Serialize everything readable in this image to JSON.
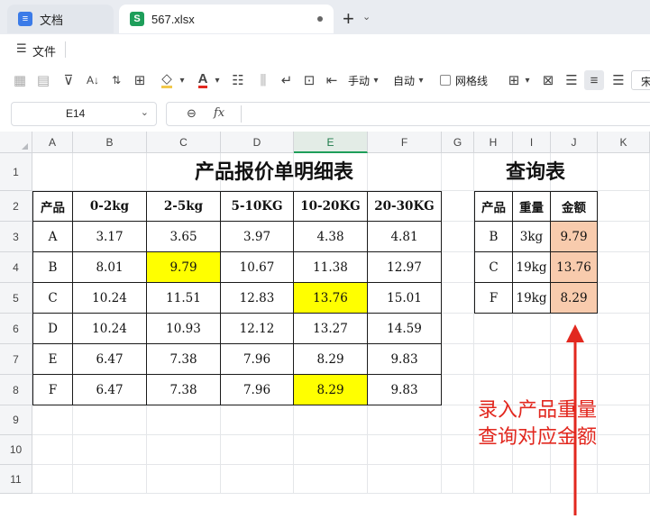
{
  "tabs": [
    {
      "label": "文档",
      "icon": "doc-icon"
    },
    {
      "label": "567.xlsx",
      "icon": "spreadsheet-icon"
    }
  ],
  "menu": {
    "file_label": "文件"
  },
  "ribbon": {
    "handdraw_label": "手动",
    "auto_label": "自动",
    "gridlines_label": "网格线",
    "overflow_char": "宋"
  },
  "namebox": {
    "value": "E14"
  },
  "formula": {
    "fx": "fx",
    "value": ""
  },
  "columns": [
    "A",
    "B",
    "C",
    "D",
    "E",
    "F",
    "G",
    "H",
    "I",
    "J",
    "K"
  ],
  "rows": [
    "1",
    "2",
    "3",
    "4",
    "5",
    "6",
    "7",
    "8",
    "9",
    "10",
    "11"
  ],
  "main_table": {
    "title": "产品报价单明细表",
    "headers": [
      "产品",
      "0-2kg",
      "2-5kg",
      "5-10KG",
      "10-20KG",
      "20-30KG"
    ],
    "rows": [
      [
        "A",
        "3.17",
        "3.65",
        "3.97",
        "4.38",
        "4.81"
      ],
      [
        "B",
        "8.01",
        "9.79",
        "10.67",
        "11.38",
        "12.97"
      ],
      [
        "C",
        "10.24",
        "11.51",
        "12.83",
        "13.76",
        "15.01"
      ],
      [
        "D",
        "10.24",
        "10.93",
        "12.12",
        "13.27",
        "14.59"
      ],
      [
        "E",
        "6.47",
        "7.38",
        "7.96",
        "8.29",
        "9.83"
      ],
      [
        "F",
        "6.47",
        "7.38",
        "7.96",
        "8.29",
        "9.83"
      ]
    ],
    "highlight_color": "#ffff00"
  },
  "query_table": {
    "title": "查询表",
    "headers": [
      "产品",
      "重量",
      "金额"
    ],
    "rows": [
      [
        "B",
        "3kg",
        "9.79"
      ],
      [
        "C",
        "19kg",
        "13.76"
      ],
      [
        "F",
        "19kg",
        "8.29"
      ]
    ],
    "result_color": "#f8cbad"
  },
  "annotation": {
    "line1": "录入产品重量",
    "line2": "查询对应金额",
    "color": "#e2281f"
  }
}
